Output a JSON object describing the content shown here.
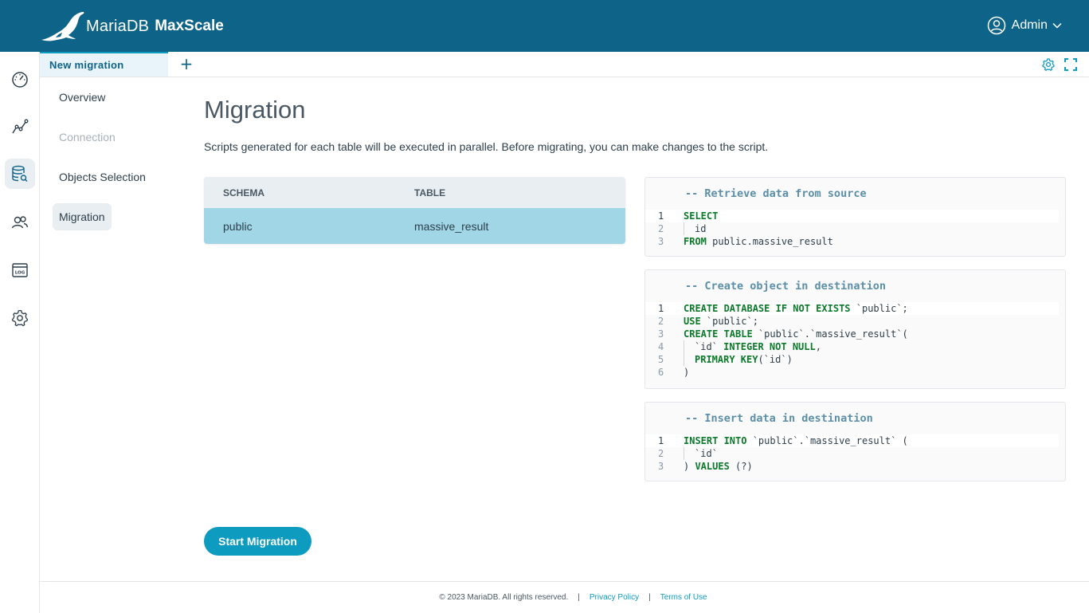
{
  "header": {
    "brand_name": "MariaDB",
    "product_name": "MaxScale",
    "user": "Admin",
    "colors": {
      "topbar": "#0e6488",
      "accent": "#0e9bc0"
    }
  },
  "rail": {
    "items": [
      {
        "icon": "dashboard-gauge-icon"
      },
      {
        "icon": "visualization-chart-icon"
      },
      {
        "icon": "query-database-icon",
        "active": true
      },
      {
        "icon": "users-icon"
      },
      {
        "icon": "logs-archive-icon"
      },
      {
        "icon": "settings-gear-icon"
      }
    ]
  },
  "tabs": {
    "items": [
      {
        "label": "New migration"
      }
    ],
    "add_label": "+",
    "right_icons": [
      "settings-gear-icon",
      "fullscreen-icon"
    ]
  },
  "steps": [
    {
      "label": "Overview",
      "state": "normal"
    },
    {
      "label": "Connection",
      "state": "disabled"
    },
    {
      "label": "Objects Selection",
      "state": "normal"
    },
    {
      "label": "Migration",
      "state": "active"
    }
  ],
  "main": {
    "title": "Migration",
    "subtitle": "Scripts generated for each table will be executed in parallel. Before migrating, you can make changes to the script.",
    "table": {
      "columns": [
        "SCHEMA",
        "TABLE"
      ],
      "rows": [
        {
          "schema": "public",
          "table": "massive_result",
          "selected": true
        }
      ]
    },
    "scripts": [
      {
        "title": "-- Retrieve data from source",
        "lines": [
          [
            {
              "t": "SELECT",
              "k": true
            }
          ],
          [
            {
              "guide": true
            },
            {
              "t": "id"
            }
          ],
          [
            {
              "t": "FROM",
              "k": true
            },
            {
              "t": " public.massive_result"
            }
          ]
        ]
      },
      {
        "title": "-- Create object in destination",
        "lines": [
          [
            {
              "t": "CREATE DATABASE IF NOT EXISTS",
              "k": true
            },
            {
              "t": " `public`;"
            }
          ],
          [
            {
              "t": "USE",
              "k": true
            },
            {
              "t": " `public`;"
            }
          ],
          [
            {
              "t": "CREATE TABLE",
              "k": true
            },
            {
              "t": " `public`.`massive_result`("
            }
          ],
          [
            {
              "guide": true
            },
            {
              "t": "`id` "
            },
            {
              "t": "INTEGER NOT NULL",
              "k": true
            },
            {
              "t": ","
            }
          ],
          [
            {
              "guide": true
            },
            {
              "t": "PRIMARY KEY",
              "k": true
            },
            {
              "t": "(`id`)"
            }
          ],
          [
            {
              "t": ")"
            }
          ]
        ]
      },
      {
        "title": "-- Insert data in destination",
        "lines": [
          [
            {
              "t": "INSERT INTO",
              "k": true
            },
            {
              "t": " `public`.`massive_result` ("
            }
          ],
          [
            {
              "guide": true
            },
            {
              "t": "`id`"
            }
          ],
          [
            {
              "t": ") "
            },
            {
              "t": "VALUES",
              "k": true
            },
            {
              "t": " (?)"
            }
          ]
        ]
      }
    ],
    "start_button": "Start Migration"
  },
  "footer": {
    "copyright": "© 2023 MariaDB. All rights reserved.",
    "sep": "|",
    "privacy": "Privacy Policy",
    "terms": "Terms of Use"
  }
}
